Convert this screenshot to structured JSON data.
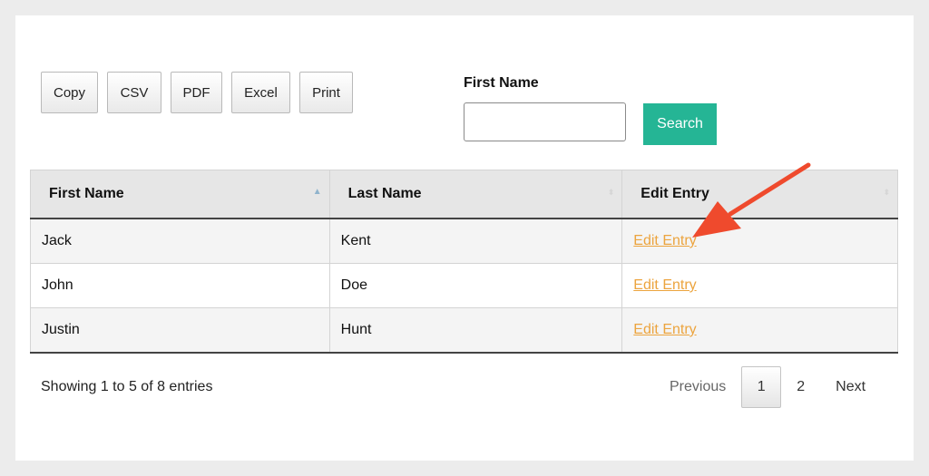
{
  "export_buttons": [
    "Copy",
    "CSV",
    "PDF",
    "Excel",
    "Print"
  ],
  "search": {
    "label": "First Name",
    "value": "",
    "button_label": "Search"
  },
  "table": {
    "headers": [
      "First Name",
      "Last Name",
      "Edit Entry"
    ],
    "sorted_column": "First Name",
    "sort_direction": "ascending",
    "rows": [
      {
        "first": "Jack",
        "last": "Kent",
        "edit": "Edit Entry"
      },
      {
        "first": "John",
        "last": "Doe",
        "edit": "Edit Entry"
      },
      {
        "first": "Justin",
        "last": "Hunt",
        "edit": "Edit Entry"
      }
    ]
  },
  "info": "Showing 1 to 5 of 8 entries",
  "pagination": {
    "previous": "Previous",
    "pages": [
      "1",
      "2"
    ],
    "current": "1",
    "next": "Next"
  },
  "colors": {
    "search_button": "#25b595",
    "edit_link": "#eca43e",
    "annotation_arrow": "#ef4a2d",
    "sort_indicator": "#8fb3cc"
  },
  "icons": {
    "sort_ascending": "triangle-up",
    "annotation": "arrow-pointing-to-edit-entry-header"
  }
}
